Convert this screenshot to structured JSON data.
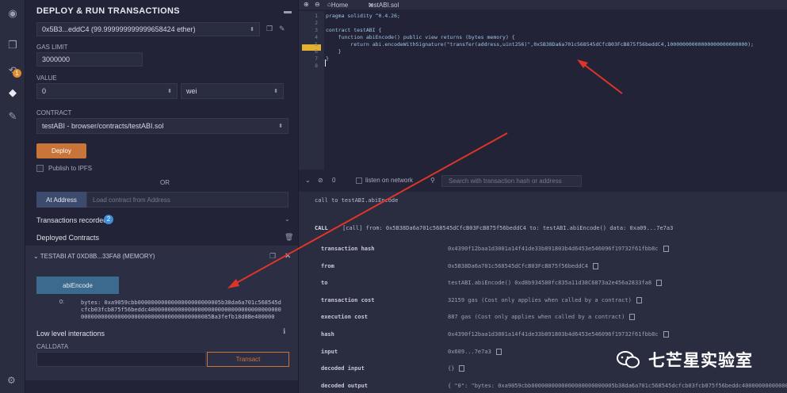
{
  "panel": {
    "title": "DEPLOY & RUN TRANSACTIONS",
    "account": "0x5B3...eddC4 (99.999999999999658424 ether)",
    "gas_limit_label": "GAS LIMIT",
    "gas_limit": "3000000",
    "value_label": "VALUE",
    "value": "0",
    "unit": "wei",
    "contract_label": "CONTRACT",
    "contract": "testABI - browser/contracts/testABI.sol",
    "deploy_label": "Deploy",
    "publish_label": "Publish to IPFS",
    "or_label": "OR",
    "at_address_label": "At Address",
    "load_placeholder": "Load contract from Address",
    "tx_recorded_label": "Transactions recorded",
    "tx_recorded_count": "2",
    "deployed_label": "Deployed Contracts",
    "instance_title": "TESTABI AT 0XD8B...33FA8 (MEMORY)",
    "function_label": "abiEncode",
    "output_index": "0:",
    "output_value": "bytes: 0xa9059cbb0000000000000000000000005b38da6a701c568545dcfcb03fcb875f56beddc4000000000000000000000000000000000000000000000000000000000000000000000000000085Ba3fefb18d8Be400000",
    "low_level_label": "Low level interactions",
    "calldata_label": "CALLDATA",
    "transact_label": "Transact"
  },
  "editor": {
    "tab_home": "Home",
    "tab_file": "testABI.sol",
    "line_numbers": [
      "1",
      "2",
      "3",
      "4",
      "5",
      "6",
      "7",
      "8"
    ],
    "lines": [
      "pragma solidity ^0.4.26;",
      "",
      "contract testABI {",
      "    function abiEncode() public view returns (bytes memory) {",
      "        return abi.encodeWithSignature(\"transfer(address,uint256)\",0x5B38Da6a701c568545dCfcB03FcB875f56beddC4,10000000000000000000000000);",
      "    }",
      "}",
      ""
    ]
  },
  "terminal": {
    "count": "0",
    "listen_label": "listen on network",
    "search_placeholder": "Search with transaction hash or address",
    "call_line": "call to testABI.abiEncode",
    "call_tag": "CALL",
    "call_summary": "[call] from: 0x5B38Da6a701c568545dCfcB03FcB875f56beddC4 to: testABI.abiEncode() data: 0xa09...7e7a3",
    "rows": [
      {
        "key": "transaction hash",
        "value": "0x4390f12baa1d3001a14f41de33b891803b4d6453e546096f19732f61fbb8c"
      },
      {
        "key": "from",
        "value": "0x5B38Da6a701c568545dCfcB03FcB875f56beddC4"
      },
      {
        "key": "to",
        "value": "testABI.abiEncode() 0xd8b934580fc835a11d38C6873a2e456a2833fa8"
      },
      {
        "key": "transaction cost",
        "value": "32159 gas (Cost only applies when called by a contract)"
      },
      {
        "key": "execution cost",
        "value": "887 gas (Cost only applies when called by a contract)"
      },
      {
        "key": "hash",
        "value": "0x4390f12baa1d3001a14f41de33b891803b4d6453e546096f19732f61fbb8c"
      },
      {
        "key": "input",
        "value": "0x609...7e7a3"
      },
      {
        "key": "decoded input",
        "value": "{}"
      },
      {
        "key": "decoded output",
        "value": "{ \"0\": \"bytes: 0xa9059cbb0000000000000000000000005b38da6a701c568545dcfcb03fcb875f56beddc4000000000000000000000000"
      }
    ]
  },
  "watermark": "七芒星实验室",
  "colors": {
    "accent": "#c97539",
    "badge": "#3d8ed8",
    "arrow": "#e0342a",
    "breakpoint": "#e3b02f"
  }
}
